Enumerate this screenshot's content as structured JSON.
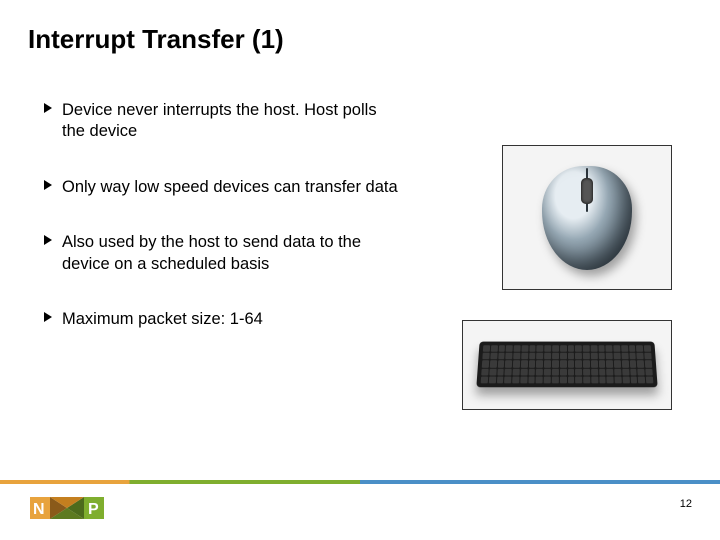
{
  "title": "Interrupt Transfer (1)",
  "bullets": [
    "Device never interrupts the host. Host polls the device",
    "Only way low speed devices can transfer data",
    "Also used by the host to send data to the device on a scheduled basis",
    "Maximum packet size: 1-64"
  ],
  "images": {
    "mouse_alt": "computer mouse",
    "keyboard_alt": "computer keyboard"
  },
  "brand": {
    "name": "NXP",
    "colors": {
      "orange": "#e8a33d",
      "green": "#7fae2e",
      "blue": "#4a8fc7"
    }
  },
  "page_number": "12"
}
